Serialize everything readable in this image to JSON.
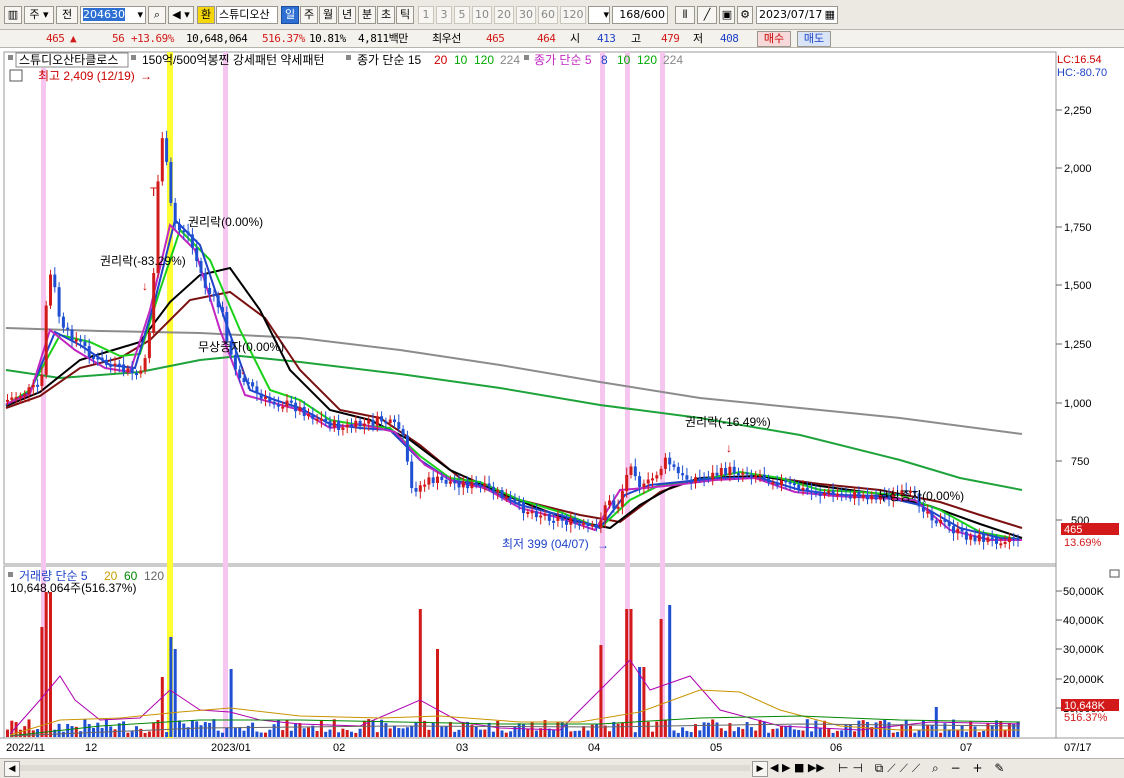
{
  "toolbar": {
    "tab_ju": "주",
    "tab_jeon": "전",
    "code": "204630",
    "hwan": "환",
    "stock_name": "스튜디오산",
    "periods": [
      "일",
      "주",
      "월",
      "년",
      "분",
      "초",
      "틱"
    ],
    "active_period": "일",
    "minutes": [
      "1",
      "3",
      "5",
      "10",
      "20",
      "30",
      "60",
      "120"
    ],
    "count": "168",
    "count_total": "/600",
    "date": "2023/07/17"
  },
  "quote": {
    "price": "465",
    "change": "56",
    "change_pct": "+13.69%",
    "volume": "10,648,064",
    "vol_ratio": "516.37%",
    "turnover": "10.81%",
    "amount": "4,811백만",
    "best_label": "최우선",
    "ask": "465",
    "bid": "464",
    "open_label": "시",
    "open": "413",
    "high_label": "고",
    "high": "479",
    "low_label": "저",
    "low": "408",
    "buy": "매수",
    "sell": "매도"
  },
  "legend_price": {
    "name": "스튜디오산타클로스",
    "pattern": "150억/500억봉찐 강세패턴  약세패턴",
    "ma_close_label": "종가 단순 15",
    "ma_close_periods": [
      "20",
      "10",
      "120",
      "224"
    ],
    "ma_close_colors": [
      "#cc0000",
      "#00aa00",
      "#00aa00",
      "#888888"
    ],
    "ma_close2_label": "종가 단순 5",
    "ma_close2_periods": [
      "8",
      "10",
      "120",
      "224"
    ],
    "ma_close2_colors": [
      "#1f43c9",
      "#00aa00",
      "#00aa00",
      "#888888"
    ],
    "lc": "LC:16.54",
    "hc": "HC:-80.70"
  },
  "legend_vol": {
    "label": "거래량 단순 5",
    "periods": [
      "20",
      "60",
      "120"
    ],
    "period_colors": [
      "#c9a000",
      "#008800",
      "#666666"
    ],
    "volume": "10,648,064주(516.37%)"
  },
  "annotations": {
    "max": "최고 2,409 (12/19)",
    "min": "최저 399 (04/07)",
    "exright1": "권리락(-83.29%)",
    "exright2": "권리락(0.00%)",
    "bonus1": "무상증자(0.00%)",
    "exright3": "권리락(-16.49%)",
    "bonus2": "무상증자(0.00%)",
    "t_marker": "T"
  },
  "price_badge": {
    "price": "465",
    "pct": "13.69%"
  },
  "vol_badge": {
    "vol": "10,648K",
    "pct": "516.37%"
  },
  "chart_data": {
    "type": "candlestick",
    "price_axis": {
      "ticks": [
        "2,250",
        "2,000",
        "1,750",
        "1,500",
        "1,250",
        "1,000",
        "750",
        "500"
      ],
      "values": [
        2250,
        2000,
        1750,
        1500,
        1250,
        1000,
        750,
        500
      ]
    },
    "volume_axis": {
      "ticks": [
        "50,000K",
        "40,000K",
        "30,000K",
        "20,000K",
        "10,000K"
      ],
      "values": [
        50000,
        40000,
        30000,
        20000,
        10000
      ]
    },
    "x_labels": [
      "2022/11",
      "12",
      "2023/01",
      "02",
      "03",
      "04",
      "05",
      "06",
      "07",
      "07/17"
    ],
    "high": 2409,
    "low": 399,
    "last": 465
  },
  "status": {
    "nav": [
      "◀",
      "▶",
      "■",
      "▶▶"
    ]
  }
}
